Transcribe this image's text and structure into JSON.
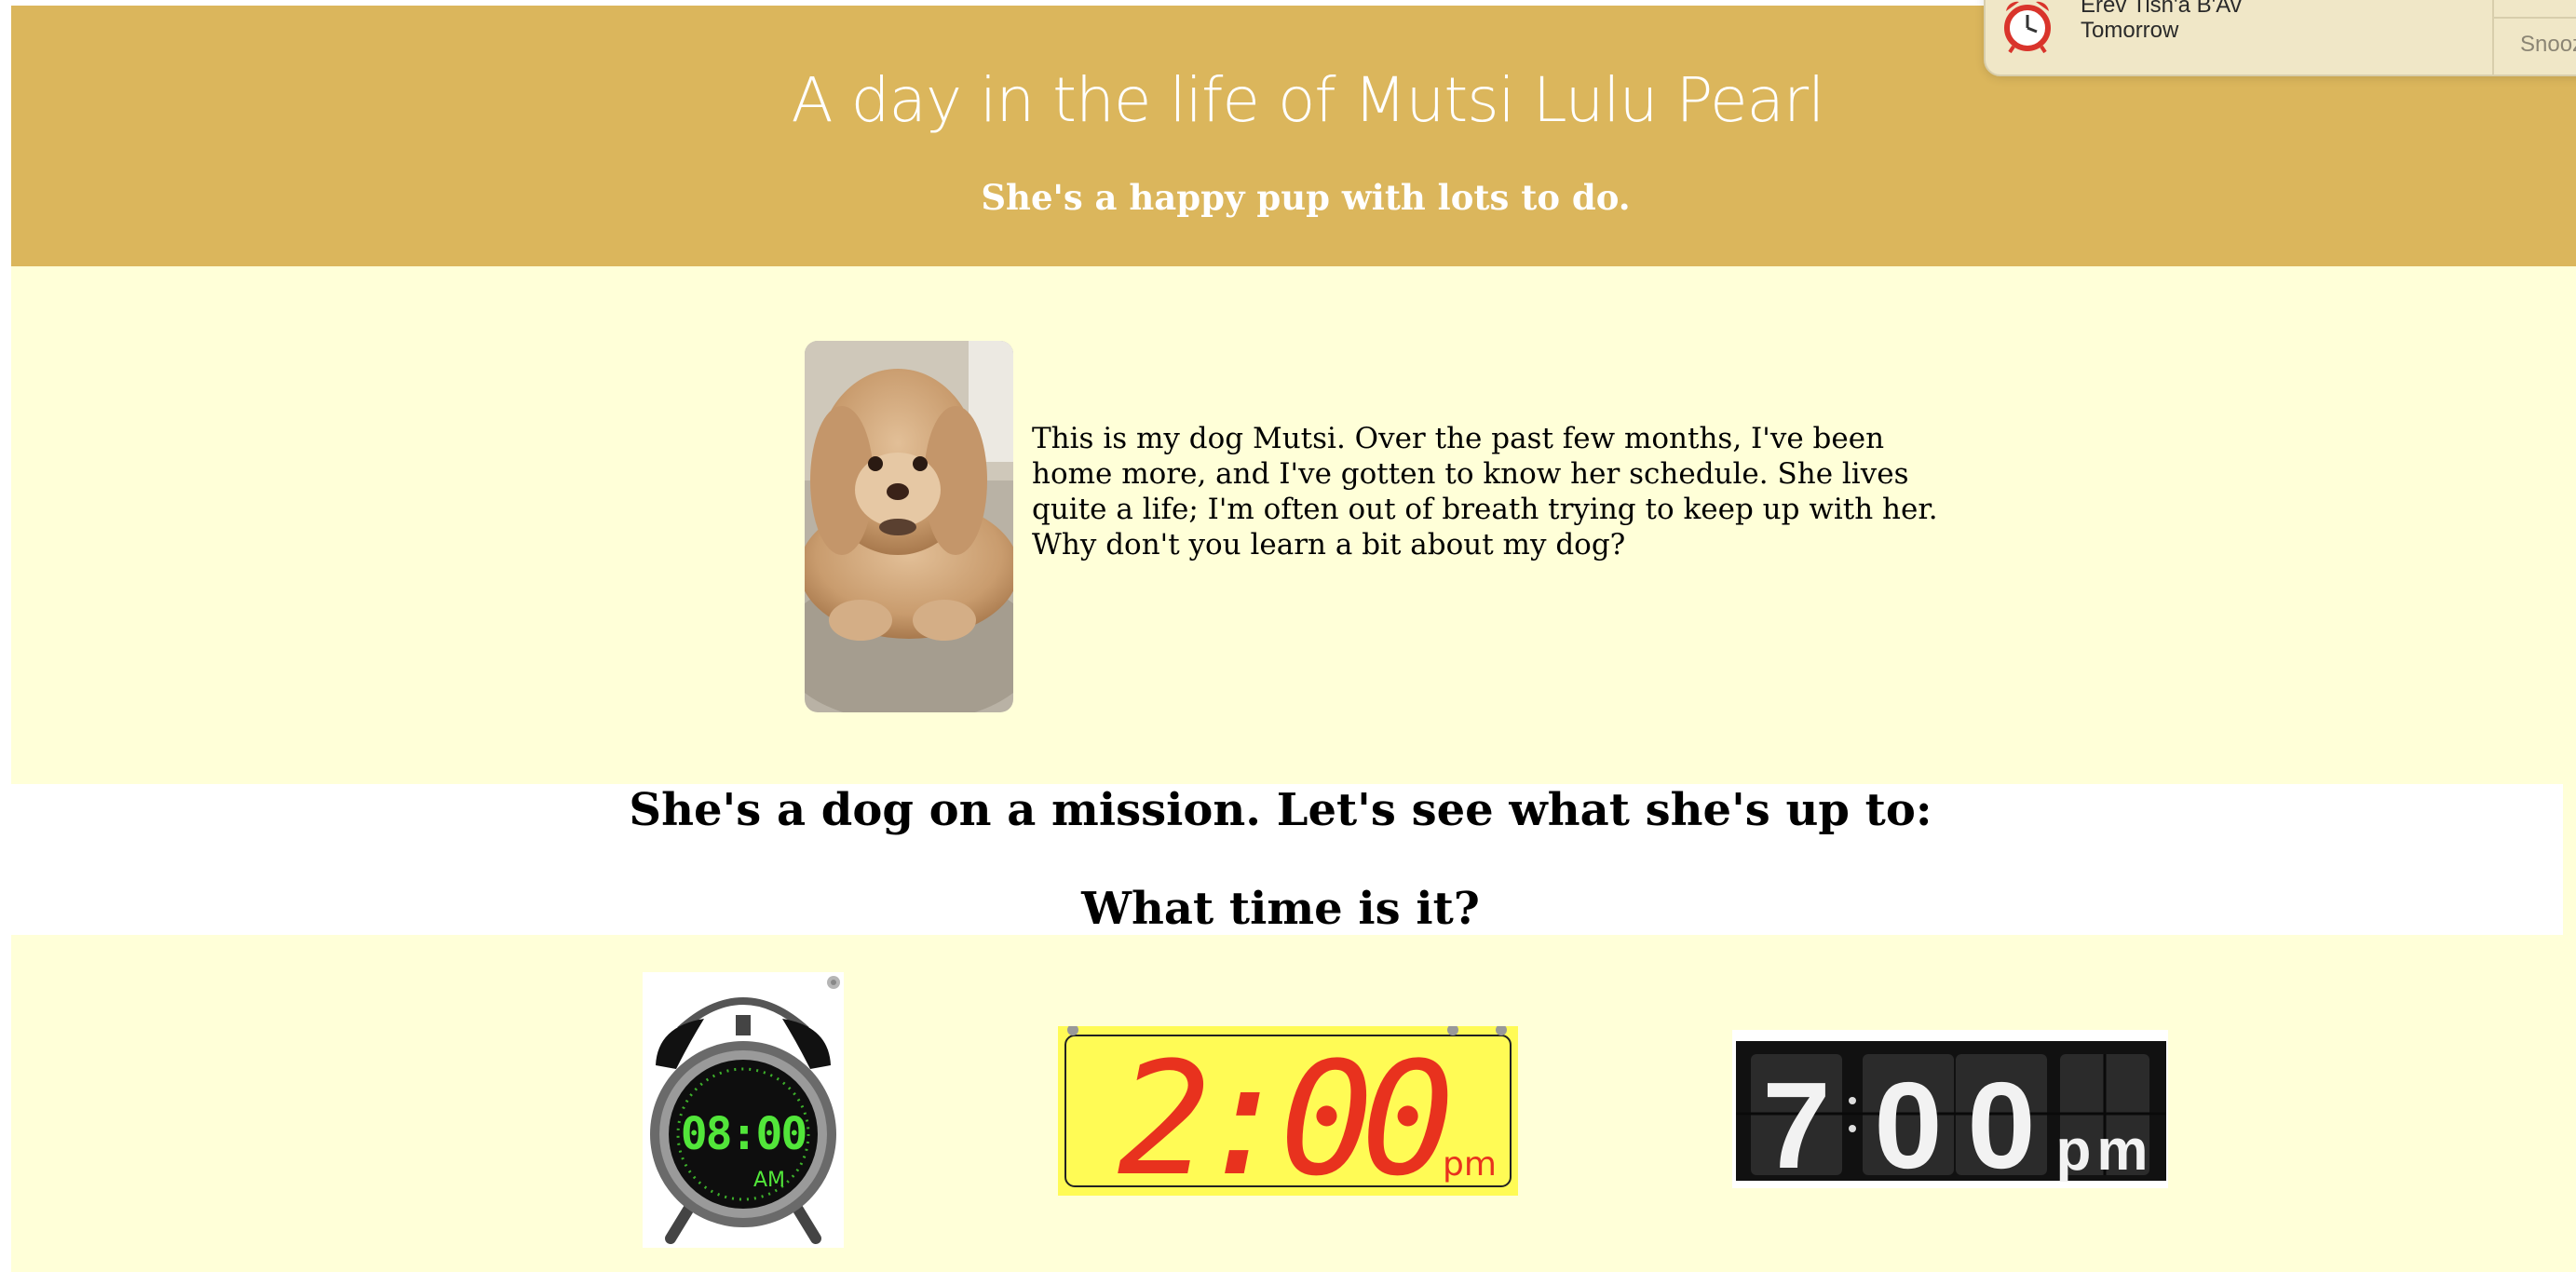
{
  "header": {
    "title": "A day in the life of Mutsi Lulu Pearl",
    "subtitle": "She's a happy pup with lots to do."
  },
  "notification": {
    "title": "Erev Tish'a B'Av",
    "time": "Tomorrow",
    "snooze_label": "Snooze",
    "icon": "alarm-clock-icon"
  },
  "intro": {
    "photo_alt": "Mutsi, a curly apricot dog lying on a carpet",
    "paragraph": "This is my dog Mutsi. Over the past few months, I've been home more, and I've gotten to know her schedule. She lives quite a life; I'm often out of breath trying to keep up with her.",
    "question": "Why don't you learn a bit about my dog?"
  },
  "mission": {
    "heading": "She's a dog on a mission. Let's see what she's up to:",
    "time_question": "What time is it?"
  },
  "clocks": [
    {
      "kind": "alarm-clock",
      "time": "08:00",
      "meridiem": "AM"
    },
    {
      "kind": "digital-display",
      "time": "2:00",
      "meridiem": "pm"
    },
    {
      "kind": "flip-clock",
      "hour": "7",
      "minute_tens": "0",
      "minute_ones": "0",
      "meridiem": "pm"
    }
  ],
  "colors": {
    "page_background": "#ffffd8",
    "header_background": "#dbb65c",
    "header_text": "#ffffff",
    "alarm_digits": "#52e63a",
    "digital_display_background": "#fffb55",
    "digital_digits": "#e8321e",
    "flip_clock_background": "#111111"
  }
}
